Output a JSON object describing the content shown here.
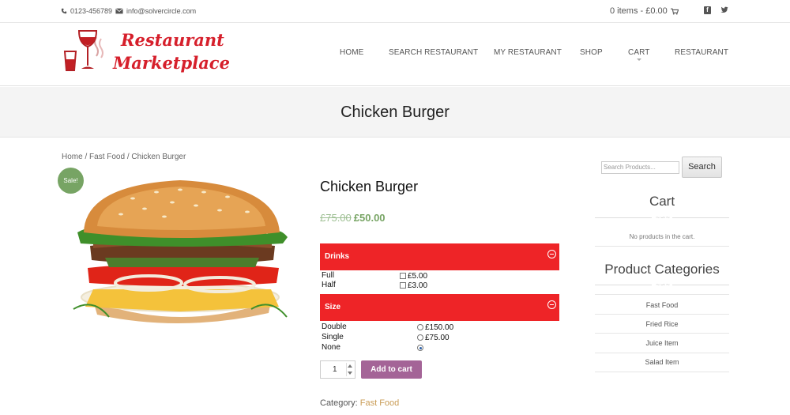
{
  "topbar": {
    "phone": "0123-456789",
    "email": "info@solvercircle.com",
    "cart_summary": "0 items - £0.00"
  },
  "logo": {
    "line1": "Restaurant",
    "line2": "Marketplace",
    "colors": {
      "brand_red": "#d61f2b",
      "glass_wine": "#c21f24"
    }
  },
  "nav": {
    "items": [
      {
        "label": "HOME"
      },
      {
        "label": "SEARCH RESTAURANT"
      },
      {
        "label": "MY RESTAURANT"
      },
      {
        "label": "SHOP"
      },
      {
        "label": "CART"
      },
      {
        "label": "RESTAURANT"
      }
    ]
  },
  "page": {
    "title": "Chicken Burger"
  },
  "breadcrumb": {
    "home": "Home",
    "sep": " / ",
    "category": "Fast Food",
    "current": "Chicken Burger"
  },
  "product": {
    "sale_badge": "Sale!",
    "name": "Chicken Burger",
    "old_price": "£75.00",
    "price": "£50.00",
    "options": {
      "drinks": {
        "label": "Drinks",
        "rows": [
          {
            "name": "Full",
            "price": "£5.00",
            "checked": false
          },
          {
            "name": "Half",
            "price": "£3.00",
            "checked": false
          }
        ]
      },
      "size": {
        "label": "Size",
        "rows": [
          {
            "name": "Double",
            "price": "£150.00",
            "checked": false
          },
          {
            "name": "Single",
            "price": "£75.00",
            "checked": false
          },
          {
            "name": "None",
            "price": "",
            "checked": true
          }
        ]
      }
    },
    "quantity": "1",
    "add_to_cart": "Add to cart",
    "category_label": "Category:",
    "category": "Fast Food",
    "colors": {
      "option_header": "#ee2427",
      "sale_price": "#77a464",
      "button": "#a46497",
      "category_link": "#c99c56"
    }
  },
  "sidebar": {
    "search_placeholder": "Search Products...",
    "search_button": "Search",
    "cart_title": "Cart",
    "cart_empty": "No products in the cart.",
    "categories_title": "Product Categories",
    "categories": [
      "Fast Food",
      "Fried Rice",
      "Juice Item",
      "Salad Item"
    ]
  }
}
